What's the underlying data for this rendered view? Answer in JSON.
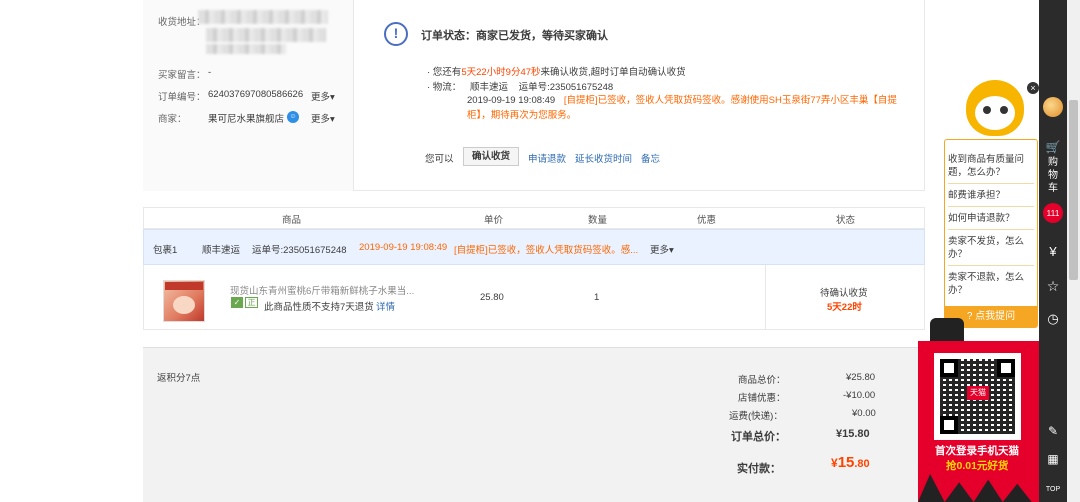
{
  "left_panel": {
    "address_label": "收货地址：",
    "buyer_note_label": "买家留言：",
    "buyer_note_value": "-",
    "order_no_label": "订单编号：",
    "order_no_value": "624037697080586626",
    "merchant_label": "商家：",
    "merchant_value": "果可尼水果旗舰店",
    "more_label": "更多▾"
  },
  "status": {
    "title": "订单状态：商家已发货，等待买家确认",
    "line1_prefix": "· 您还有",
    "line1_countdown": "5天22小时9分47秒",
    "line1_suffix": "来确认收货,超时订单自动确认收货",
    "line2_label": "· 物流：",
    "line2_carrier": "顺丰速运",
    "line2_tracking": "运单号:235051675248",
    "line3_date": "2019-09-19 19:08:49",
    "line3_text": "[自提柜]已签收，签收人凭取货码签收。感谢使用SH玉泉街77弄小区丰巢【自提柜】，期待再次为您服务。",
    "actions_label": "您可以",
    "confirm_btn": "确认收货",
    "refund_link": "申请退款",
    "extend_link": "延长收货时间",
    "memo_link": "备忘"
  },
  "table": {
    "headers": [
      "商品",
      "单价",
      "数量",
      "优惠",
      "状态"
    ],
    "package": {
      "label": "包裹1",
      "carrier": "顺丰速运",
      "tracking": "运单号:235051675248",
      "date": "2019-09-19 19:08:49",
      "text": "[自提柜]已签收，签收人凭取货码签收。感...",
      "more": "更多▾"
    },
    "item": {
      "title": "现货山东青州蜜桃6斤带箱新鲜桃子水果当...",
      "note": "此商品性质不支持7天退货",
      "detail_link": "详情",
      "badge_z": "正",
      "price": "25.80",
      "qty": "1",
      "status": "待确认收货",
      "countdown": "5天22时"
    }
  },
  "summary": {
    "points": "返积分7点",
    "goods_total_label": "商品总价：",
    "goods_total": "¥25.80",
    "shop_discount_label": "店铺优惠：",
    "shop_discount": "-¥10.00",
    "shipping_label": "运费(快递)：",
    "shipping": "¥0.00",
    "order_total_label": "订单总价：",
    "order_total": "¥15.80",
    "paid_label": "实付款：",
    "paid_symbol": "¥",
    "paid_int": "15",
    "paid_dec": ".80"
  },
  "sidebar": {
    "cart_label": "购物车",
    "cart_count": "111",
    "yen": "¥",
    "top": "TOP"
  },
  "helper": {
    "q1": "收到商品有质量问题，怎么办？",
    "q2": "邮费谁承担？",
    "q3": "如何申请退款？",
    "q4": "卖家不发货，怎么办？",
    "q5": "卖家不退款，怎么办？",
    "ask_btn": "点我提问",
    "close": "×"
  },
  "tmall": {
    "qr_label": "天猫",
    "promo1": "首次登录手机天猫",
    "promo2": "抢0.01元好货"
  },
  "colors": {
    "accent_red": "#ff4400",
    "tmall_red": "#e4002b",
    "helper_orange": "#f5a623",
    "link_blue": "#2d6ab4"
  }
}
